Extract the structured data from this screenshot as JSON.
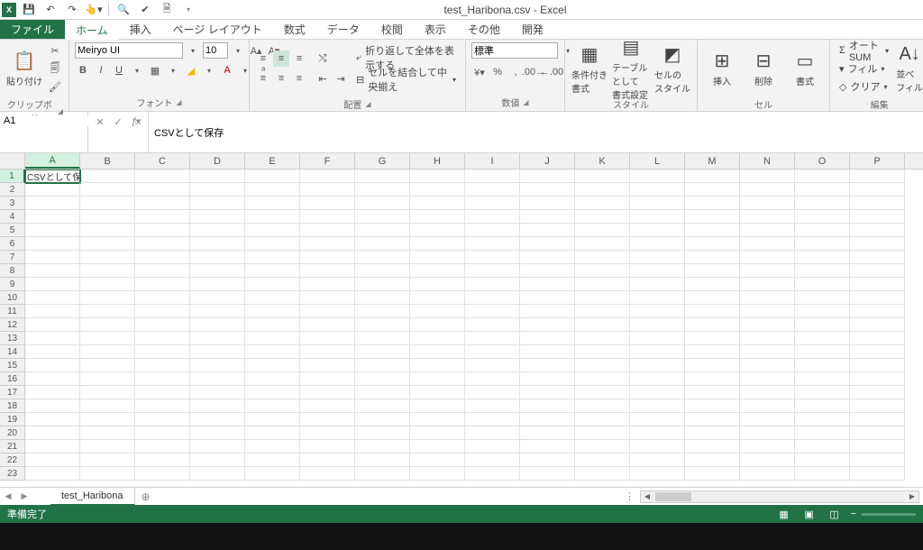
{
  "title": "test_Haribona.csv - Excel",
  "qat": {
    "appLetter": "X"
  },
  "tabs": {
    "file": "ファイル",
    "home": "ホーム",
    "insert": "挿入",
    "pageLayout": "ページ レイアウト",
    "formulas": "数式",
    "data": "データ",
    "review": "校閲",
    "view": "表示",
    "other": "その他",
    "developer": "開発"
  },
  "ribbon": {
    "clipboard": {
      "label": "クリップボード",
      "paste": "貼り付け"
    },
    "font": {
      "label": "フォント",
      "fontName": "Meiryo UI",
      "fontSize": "10"
    },
    "alignment": {
      "label": "配置",
      "wrap": "折り返して全体を表示する",
      "merge": "セルを結合して中央揃え"
    },
    "number": {
      "label": "数値",
      "format": "標準"
    },
    "styles": {
      "label": "スタイル",
      "cond": "条件付き\n書式",
      "table": "テーブルとして\n書式設定",
      "cell": "セルの\nスタイル"
    },
    "cells": {
      "label": "セル",
      "insert": "挿入",
      "delete": "削除",
      "format": "書式"
    },
    "editing": {
      "label": "編集",
      "autosum": "オート SUM",
      "fill": "フィル",
      "clear": "クリア",
      "sort": "並べ\nフィル"
    }
  },
  "formulaBar": {
    "nameBox": "A1",
    "formula": "CSVとして保存"
  },
  "sheet": {
    "columns": [
      "A",
      "B",
      "C",
      "D",
      "E",
      "F",
      "G",
      "H",
      "I",
      "J",
      "K",
      "L",
      "M",
      "N",
      "O",
      "P"
    ],
    "rowCount": 23,
    "selectedCell": {
      "row": 1,
      "col": 0
    },
    "cells": {
      "A1": "CSVとして保存"
    }
  },
  "sheetTabs": {
    "active": "test_Haribona"
  },
  "statusBar": {
    "ready": "準備完了"
  }
}
